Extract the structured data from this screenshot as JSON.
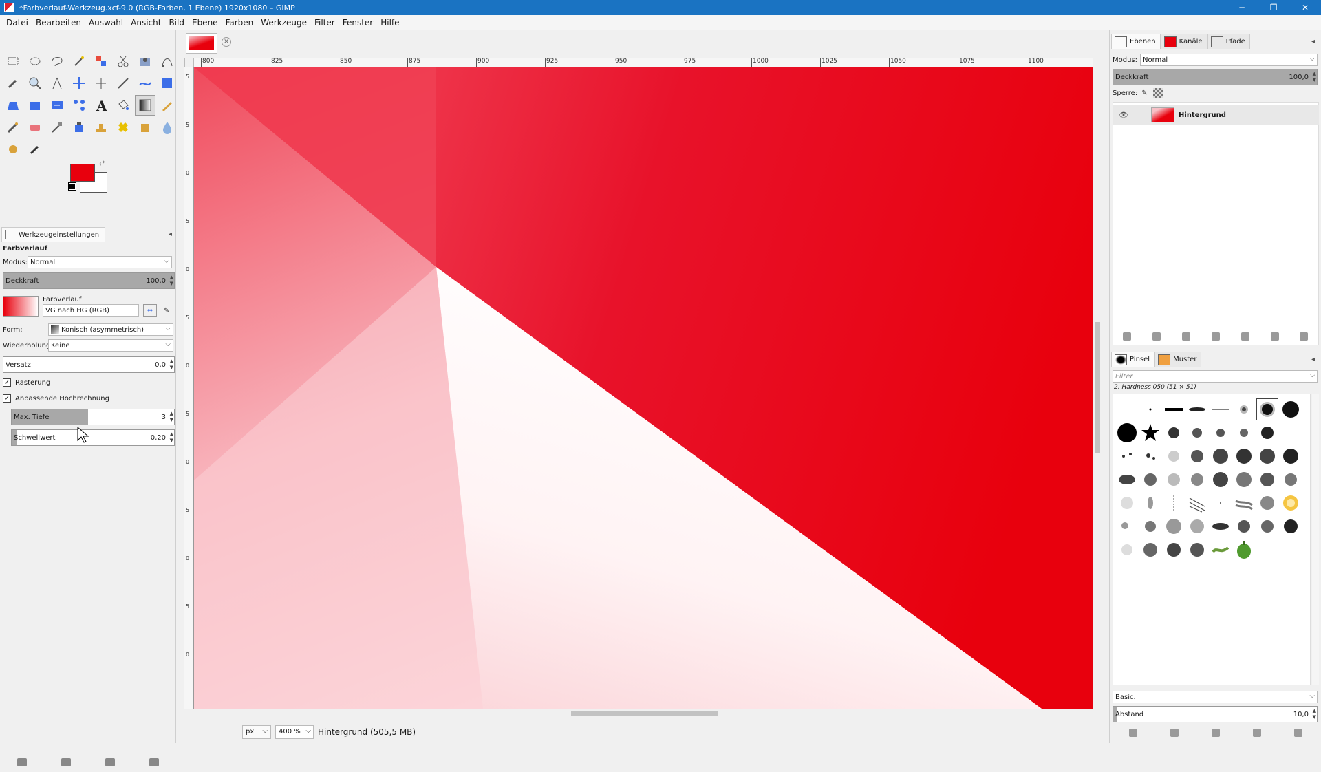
{
  "window": {
    "title": "*Farbverlauf-Werkzeug.xcf-9.0 (RGB-Farben, 1 Ebene) 1920x1080 – GIMP",
    "controls": {
      "minimize": "─",
      "maximize": "❐",
      "close": "✕"
    }
  },
  "menu": [
    "Datei",
    "Bearbeiten",
    "Auswahl",
    "Ansicht",
    "Bild",
    "Ebene",
    "Farben",
    "Werkzeuge",
    "Filter",
    "Fenster",
    "Hilfe"
  ],
  "colors": {
    "foreground": "#e8000d",
    "background": "#ffffff"
  },
  "tool_options": {
    "tab_label": "Werkzeugeinstellungen",
    "heading": "Farbverlauf",
    "mode_label": "Modus:",
    "mode_value": "Normal",
    "opacity_label": "Deckkraft",
    "opacity_value": "100,0",
    "gradient_label": "Farbverlauf",
    "gradient_value": "VG nach HG (RGB)",
    "shape_label": "Form:",
    "shape_value": "Konisch (asymmetrisch)",
    "repeat_label": "Wiederholung:",
    "repeat_value": "Keine",
    "offset_label": "Versatz",
    "offset_value": "0,0",
    "dither_label": "Rasterung",
    "adaptive_label": "Anpassende Hochrechnung",
    "maxdepth_label": "Max. Tiefe",
    "maxdepth_value": "3",
    "threshold_label": "Schwellwert",
    "threshold_value": "0,20"
  },
  "rulers": {
    "h": [
      "800",
      "825",
      "850",
      "875",
      "900",
      "925",
      "950",
      "975",
      "1000",
      "1025",
      "1050",
      "1075",
      "1100"
    ],
    "v": [
      "5",
      "5",
      "0",
      "5",
      "0",
      "5",
      "0",
      "5",
      "0",
      "5",
      "0",
      "5",
      "0"
    ]
  },
  "status": {
    "unit": "px",
    "zoom": "400 %",
    "info": "Hintergrund (505,5 MB)"
  },
  "layers_dock": {
    "tabs": [
      "Ebenen",
      "Kanäle",
      "Pfade"
    ],
    "mode_label": "Modus:",
    "mode_value": "Normal",
    "opacity_label": "Deckkraft",
    "opacity_value": "100,0",
    "lock_label": "Sperre:",
    "layer_name": "Hintergrund"
  },
  "brushes_dock": {
    "tabs": [
      "Pinsel",
      "Muster"
    ],
    "filter_placeholder": "Filter",
    "selected_brush": "2. Hardness 050 (51 × 51)",
    "preset": "Basic.",
    "spacing_label": "Abstand",
    "spacing_value": "10,0"
  }
}
